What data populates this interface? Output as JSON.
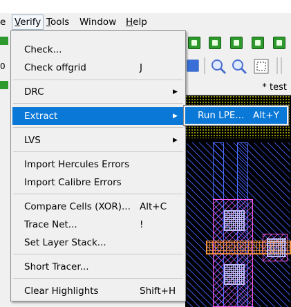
{
  "menubar": {
    "items": [
      {
        "label": "e"
      },
      {
        "label": "Verify",
        "underline": "V"
      },
      {
        "label": "Tools",
        "underline": "T"
      },
      {
        "label": "Window"
      },
      {
        "label": "Help",
        "underline": "H"
      }
    ]
  },
  "left_strip": {
    "row_value": "0"
  },
  "canvas": {
    "tab_label": "* test"
  },
  "verify_menu": {
    "items": [
      {
        "label": "Check...",
        "shortcut": ""
      },
      {
        "label": "Check offgrid",
        "shortcut": "J"
      },
      {
        "label": "DRC",
        "submenu": true
      },
      {
        "label": "Extract",
        "submenu": true,
        "highlighted": true
      },
      {
        "label": "LVS",
        "submenu": true
      },
      {
        "label": "Import Hercules Errors"
      },
      {
        "label": "Import Calibre Errors"
      },
      {
        "label": "Compare Cells (XOR)...",
        "shortcut": "Alt+C"
      },
      {
        "label": "Trace Net...",
        "shortcut": "!"
      },
      {
        "label": "Set Layer Stack..."
      },
      {
        "label": "Short Tracer..."
      },
      {
        "label": "Clear Highlights",
        "shortcut": "Shift+H"
      }
    ]
  },
  "extract_submenu": {
    "items": [
      {
        "label": "Run LPE...",
        "shortcut": "Alt+Y",
        "highlighted": true
      }
    ]
  },
  "colors": {
    "highlight": "#0a78d7",
    "menu_bg": "#f0f0f0",
    "canvas_bg": "#000000"
  }
}
